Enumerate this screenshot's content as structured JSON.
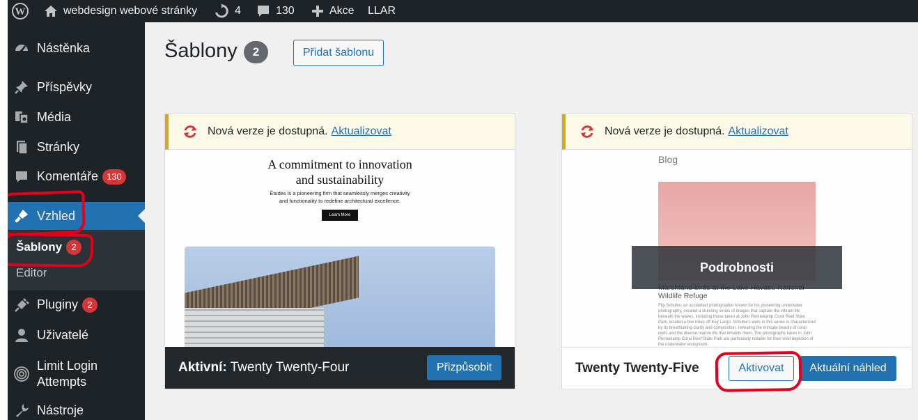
{
  "adminbar": {
    "site_name": "webdesign webové stránky",
    "updates_count": "4",
    "comments_count": "130",
    "new_label": "Akce",
    "llar_label": "LLAR"
  },
  "sidebar": {
    "items": [
      {
        "label": "Nástěnka",
        "icon": "dashboard-icon"
      },
      {
        "label": "Příspěvky",
        "icon": "pin-icon"
      },
      {
        "label": "Média",
        "icon": "media-icon"
      },
      {
        "label": "Stránky",
        "icon": "pages-icon"
      },
      {
        "label": "Komentáře",
        "icon": "comments-icon",
        "badge": "130"
      },
      {
        "label": "Vzhled",
        "icon": "appearance-icon"
      },
      {
        "label": "Pluginy",
        "icon": "plugins-icon",
        "badge": "2"
      },
      {
        "label": "Uživatelé",
        "icon": "users-icon"
      },
      {
        "label": "Limit Login",
        "label2": "Attempts",
        "icon": "fingerprint-icon"
      },
      {
        "label": "Nástroje",
        "icon": "tools-icon"
      }
    ],
    "submenu": [
      {
        "label": "Šablony",
        "badge": "2"
      },
      {
        "label": "Editor"
      }
    ]
  },
  "main": {
    "title": "Šablony",
    "count": "2",
    "add_button": "Přidat šablonu"
  },
  "themes": [
    {
      "notice_text": "Nová verze je dostupná.",
      "notice_link": "Aktualizovat",
      "preview_title_line1": "A commitment to innovation",
      "preview_title_line2": "and sustainability",
      "preview_desc_line1": "Études is a pioneering firm that seamlessly merges creativity",
      "preview_desc_line2": "and functionality to redefine architectural excellence.",
      "preview_button": "Learn More",
      "active_prefix": "Aktivní:",
      "name": "Twenty Twenty-Four",
      "customize_button": "Přizpůsobit"
    },
    {
      "notice_text": "Nová verze je dostupná.",
      "notice_link": "Aktualizovat",
      "preview_label": "Blog",
      "details_overlay": "Podrobnosti",
      "preview_caption": "Marshland birds at the Lake Havasu National Wildlife Refuge",
      "preview_body": "Flip Schulke, an acclaimed photographer known for his pioneering underwater photography, created a stunning series of images that capture the vibrant life beneath the waves, including those taken at John Pennekamp Coral Reef State Park, located a few miles off Key Largo. Schulke's work in this series is characterized by its breathtaking clarity and composition, revealing the intricate beauty of coral reefs and the diverse marine life that inhabits them. The photographs taken in John Pennekamp Coral Reef State Park are particularly notable for their vivid depiction of the underwater ecosystem.",
      "name": "Twenty Twenty-Five",
      "activate_button": "Aktivovat",
      "preview_button": "Aktuální náhled"
    }
  ],
  "colors": {
    "admin_dark": "#1d2327",
    "accent": "#2271b1",
    "badge_red": "#d63638",
    "annotation_red": "#e3001b"
  }
}
